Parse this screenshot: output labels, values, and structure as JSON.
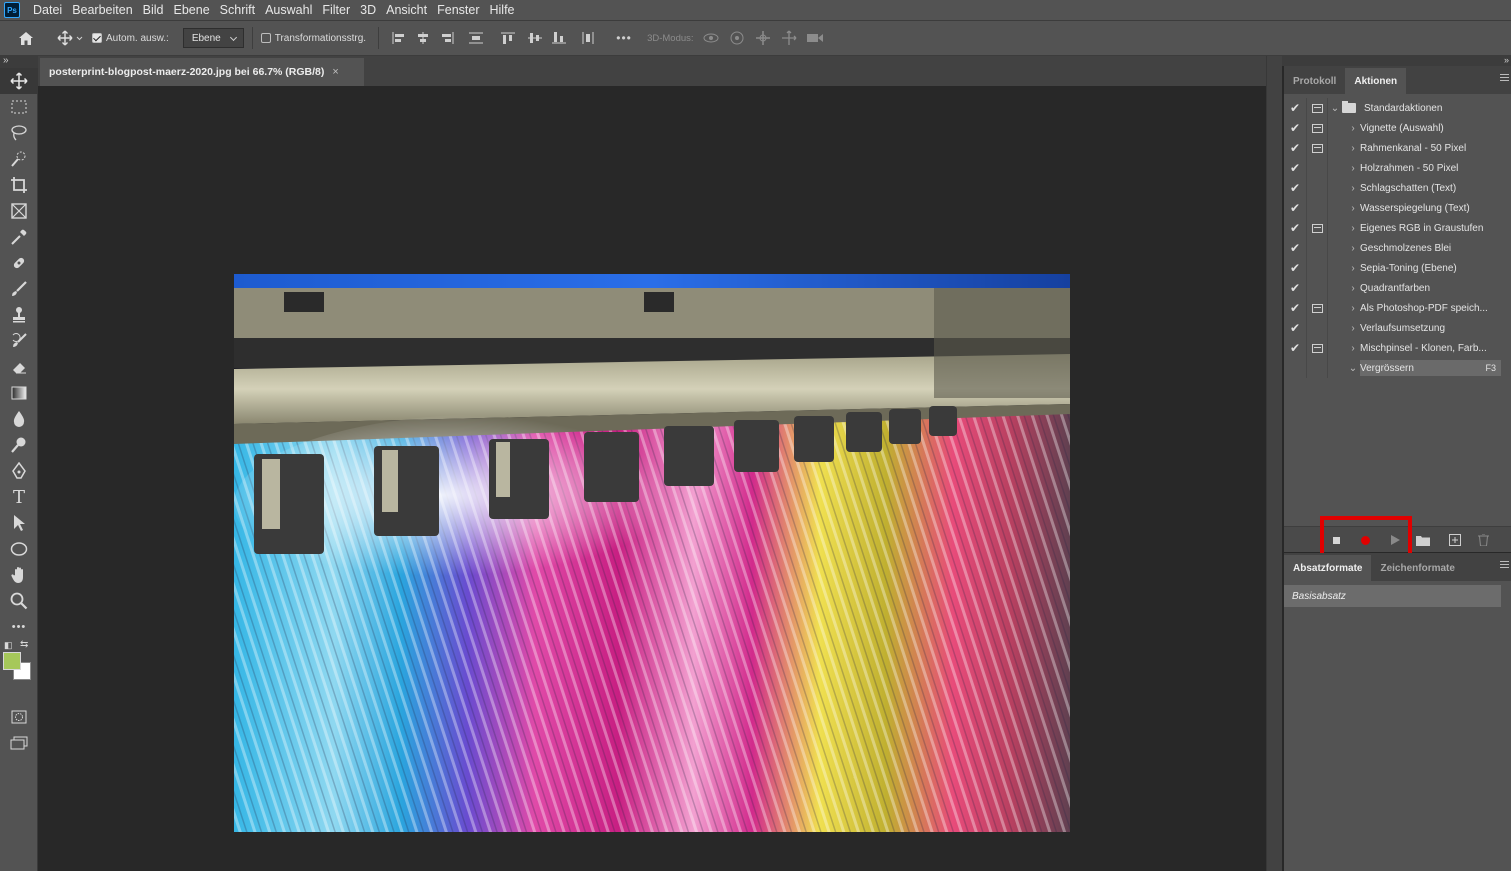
{
  "menubar": {
    "logo": "Ps",
    "items": [
      "Datei",
      "Bearbeiten",
      "Bild",
      "Ebene",
      "Schrift",
      "Auswahl",
      "Filter",
      "3D",
      "Ansicht",
      "Fenster",
      "Hilfe"
    ]
  },
  "options": {
    "auto_select_label": "Autom. ausw.:",
    "auto_select_value": "Ebene",
    "transform_label": "Transformationsstrg.",
    "mode_3d_label": "3D-Modus:",
    "more_label": "•••"
  },
  "document": {
    "tab_title": "posterprint-blogpost-maerz-2020.jpg bei 66.7% (RGB/8)",
    "close_glyph": "×"
  },
  "colors": {
    "foreground": "#a6c85a",
    "background": "#ffffff",
    "highlight": "#e00000"
  },
  "panels": {
    "top_tabs": [
      "Protokoll",
      "Aktionen"
    ],
    "active_top_tab": "Aktionen",
    "actions": [
      {
        "label": "Standardaktionen",
        "checked": true,
        "dialog": true,
        "folder": true,
        "expanded": true
      },
      {
        "label": "Vignette (Auswahl)",
        "checked": true,
        "dialog": true
      },
      {
        "label": "Rahmenkanal - 50 Pixel",
        "checked": true,
        "dialog": true
      },
      {
        "label": "Holzrahmen - 50 Pixel",
        "checked": true,
        "dialog": false
      },
      {
        "label": "Schlagschatten (Text)",
        "checked": true,
        "dialog": false
      },
      {
        "label": "Wasserspiegelung (Text)",
        "checked": true,
        "dialog": false
      },
      {
        "label": "Eigenes RGB in Graustufen",
        "checked": true,
        "dialog": true
      },
      {
        "label": "Geschmolzenes Blei",
        "checked": true,
        "dialog": false
      },
      {
        "label": "Sepia-Toning (Ebene)",
        "checked": true,
        "dialog": false
      },
      {
        "label": "Quadrantfarben",
        "checked": true,
        "dialog": false
      },
      {
        "label": "Als Photoshop-PDF speich...",
        "checked": true,
        "dialog": true
      },
      {
        "label": "Verlaufsumsetzung",
        "checked": true,
        "dialog": false
      },
      {
        "label": "Mischpinsel - Klonen, Farb...",
        "checked": true,
        "dialog": true
      },
      {
        "label": "Vergrössern",
        "checked": false,
        "dialog": false,
        "selected": true,
        "expanded": true,
        "key": "F3"
      }
    ],
    "bottom_tabs": [
      "Absatzformate",
      "Zeichenformate"
    ],
    "active_bottom_tab": "Absatzformate",
    "paragraph_style": "Basisabsatz"
  }
}
